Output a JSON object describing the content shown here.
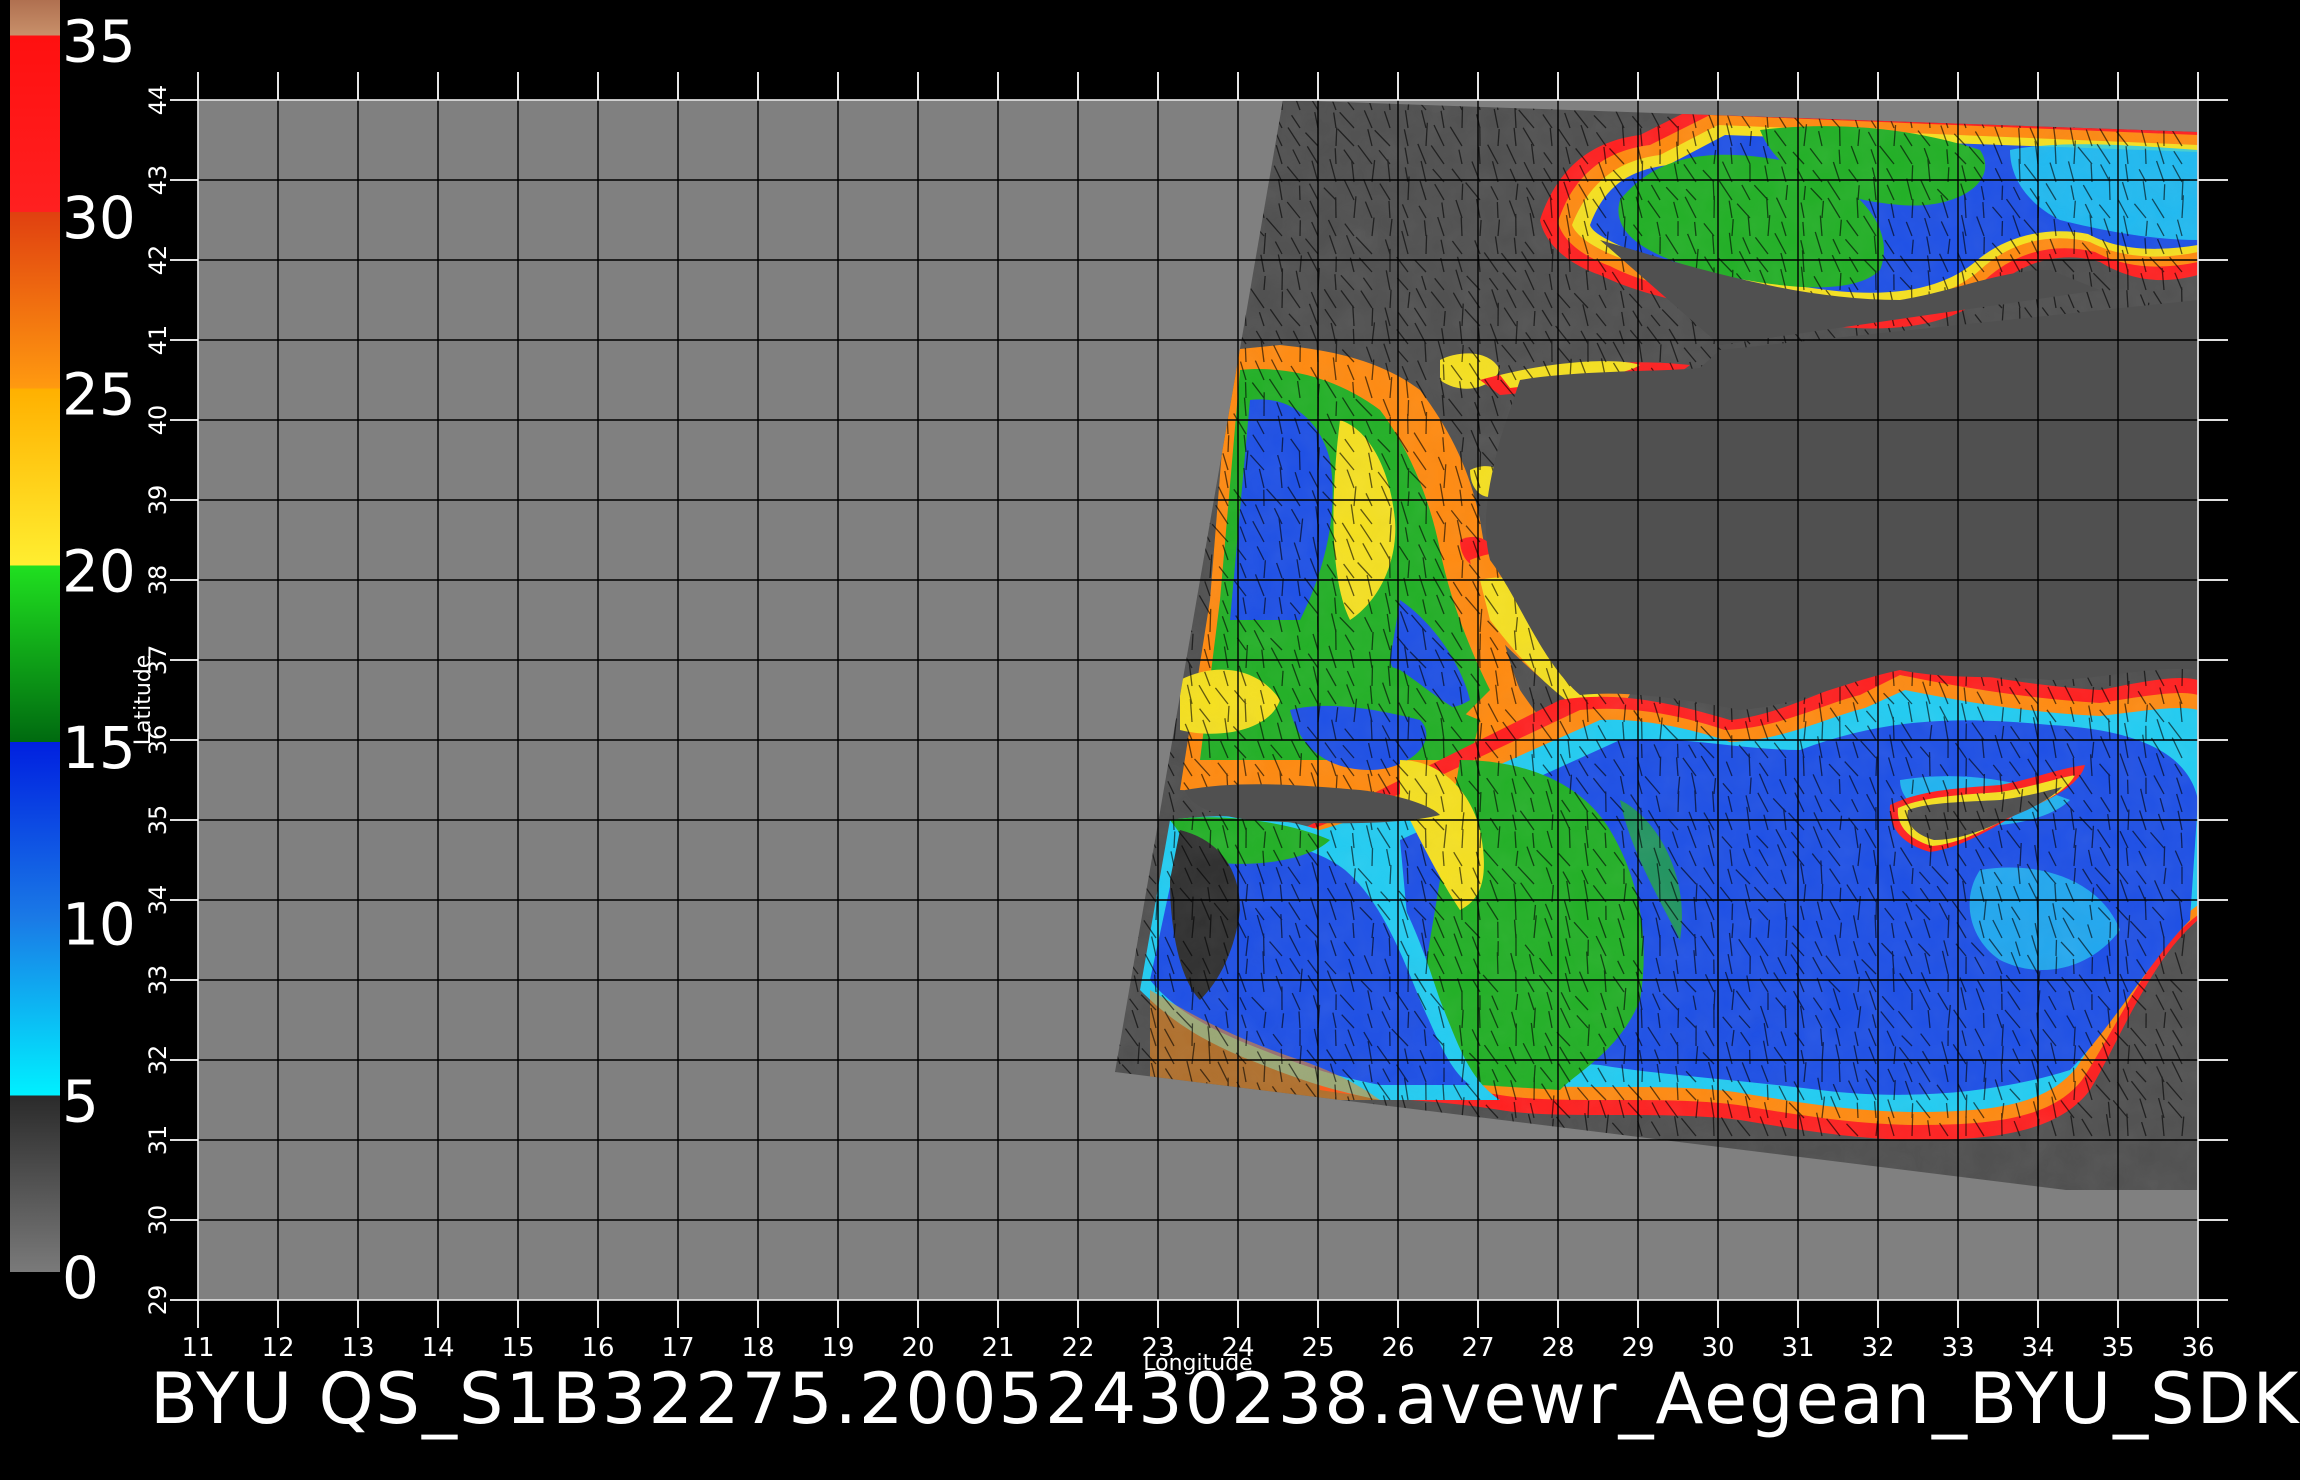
{
  "caption": "BYU QS_S1B32275.20052430238.avewr_Aegean_BYU_SDK",
  "axes": {
    "xlabel": "Longitude",
    "ylabel": "Latitude",
    "lon_ticks": [
      11,
      12,
      13,
      14,
      15,
      16,
      17,
      18,
      19,
      20,
      21,
      22,
      23,
      24,
      25,
      26,
      27,
      28,
      29,
      30,
      31,
      32,
      33,
      34,
      35,
      36
    ],
    "lat_ticks": [
      29,
      30,
      31,
      32,
      33,
      34,
      35,
      36,
      37,
      38,
      39,
      40,
      41,
      42,
      43,
      44
    ]
  },
  "colorbar": {
    "labels": [
      "0",
      "5",
      "10",
      "15",
      "20",
      "25",
      "30",
      "35"
    ],
    "values": [
      0,
      5,
      10,
      15,
      20,
      25,
      30,
      35
    ],
    "bands": [
      {
        "from": 0,
        "to": 5,
        "color": "#555555"
      },
      {
        "from": 5,
        "to": 10,
        "color": "#22ccf2"
      },
      {
        "from": 10,
        "to": 15,
        "color": "#1040e8"
      },
      {
        "from": 15,
        "to": 20,
        "color": "#10a020"
      },
      {
        "from": 20,
        "to": 25,
        "color": "#ffd21a"
      },
      {
        "from": 25,
        "to": 30,
        "color": "#ff7a10"
      },
      {
        "from": 30,
        "to": 35,
        "color": "#ff2020"
      },
      {
        "from": 35,
        "to": 36,
        "color": "#c07a5a"
      }
    ]
  },
  "colors": {
    "background": "#000000",
    "land_fill": "#808080",
    "swath_fill": "#505050",
    "grid": "#000000",
    "calm": "#303030",
    "low": "#22ccf2",
    "moderate": "#1e50e6",
    "fresh": "#22b026",
    "strong": "#f5e020",
    "gale": "#ff8a10",
    "storm": "#ff2020",
    "edge": "#c020c0"
  }
}
